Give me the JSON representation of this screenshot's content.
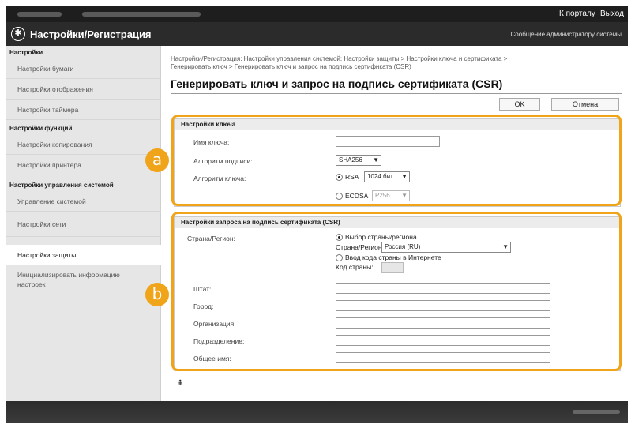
{
  "topbar": {
    "portal": "К порталу",
    "logout": "Выход"
  },
  "header": {
    "title": "Настройки/Регистрация",
    "admin_message": "Сообщение администратору системы"
  },
  "sidebar": {
    "group1": "Настройки",
    "paper": "Настройки бумаги",
    "display": "Настройки отображения",
    "timer": "Настройки таймера",
    "group2": "Настройки функций",
    "copy": "Настройки копирования",
    "printer": "Настройки принтера",
    "group3": "Настройки управления системой",
    "system": "Управление системой",
    "network": "Настройки сети",
    "security": "Настройки защиты",
    "init_line1": "Инициализировать информацию",
    "init_line2": "настроек"
  },
  "main": {
    "breadcrumb_line1": "Настройки/Регистрация: Настройки управления системой: Настройки защиты > Настройки ключа и сертификата >",
    "breadcrumb_line2": "Генерировать ключ > Генерировать ключ и запрос на подпись сертификата (CSR)",
    "title": "Генерировать ключ и запрос на подпись сертификата (CSR)",
    "ok": "OK",
    "cancel": "Отмена"
  },
  "key_settings": {
    "heading": "Настройки ключа",
    "key_name_label": "Имя ключа:",
    "key_name_value": "",
    "signature_label": "Алгоритм подписи:",
    "signature_value": "SHA256",
    "key_algorithm_label": "Алгоритм ключа:",
    "rsa_label": "RSA",
    "rsa_size": "1024 бит",
    "ecdsa_label": "ECDSA",
    "ecdsa_size": "P256"
  },
  "csr_settings": {
    "heading": "Настройки запроса на подпись сертификата (CSR)",
    "country_label": "Страна/Регион:",
    "select_option": "Выбор страны/региона",
    "country_select_label": "Страна/Регион:",
    "country_value": "Россия (RU)",
    "internet_option": "Ввод кода страны в Интернете",
    "code_label": "Код страны:",
    "state_label": "Штат:",
    "city_label": "Город:",
    "org_label": "Организация:",
    "unit_label": "Подразделение:",
    "common_label": "Общее имя:"
  },
  "callouts": {
    "a": "a",
    "b": "b"
  },
  "colors": {
    "accent": "#f0a419",
    "topbar": "#1e1e1e"
  }
}
